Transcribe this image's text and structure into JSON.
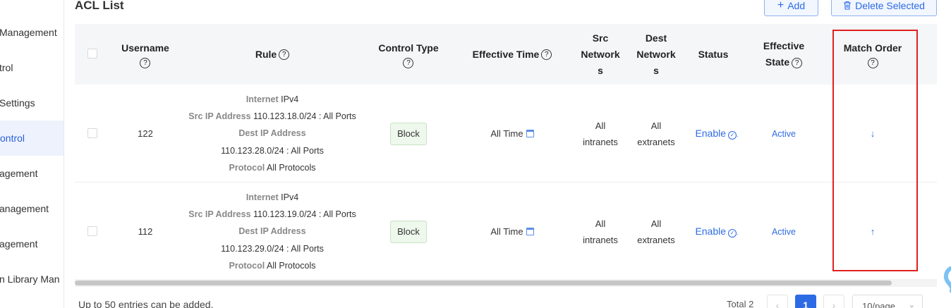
{
  "sidebar": {
    "items": [
      {
        "label": "Management"
      },
      {
        "label": "trol"
      },
      {
        "label": "Settings"
      },
      {
        "label": "ontrol"
      },
      {
        "label": "agement"
      },
      {
        "label": "anagement"
      },
      {
        "label": "agement"
      },
      {
        "label": "n Library Man"
      }
    ]
  },
  "page": {
    "title": "ACL List",
    "add_label": "Add",
    "delete_label": "Delete Selected"
  },
  "table": {
    "headers": {
      "username": "Username",
      "rule": "Rule",
      "control_type": "Control Type",
      "effective_time": "Effective Time",
      "src_networks_1": "Src",
      "src_networks_2": "Network",
      "src_networks_3": "s",
      "dest_networks_1": "Dest",
      "dest_networks_2": "Network",
      "dest_networks_3": "s",
      "status": "Status",
      "effective_state_1": "Effective",
      "effective_state_2": "State",
      "match_order": "Match Order",
      "help_symbol": "?"
    },
    "rule_keys": {
      "internet": "Internet",
      "src_ip": "Src IP Address",
      "dest_ip": "Dest IP Address",
      "protocol": "Protocol"
    },
    "rows": [
      {
        "username": "122",
        "internet": "IPv4",
        "src_ip": "110.123.18.0/24 : All Ports",
        "dest_ip": "110.123.28.0/24 : All Ports",
        "protocol": "All Protocols",
        "control_type": "Block",
        "effective_time": "All Time",
        "src_networks_1": "All",
        "src_networks_2": "intranets",
        "dest_networks_1": "All",
        "dest_networks_2": "extranets",
        "status": "Enable",
        "effective_state": "Active",
        "match_order": "↓"
      },
      {
        "username": "112",
        "internet": "IPv4",
        "src_ip": "110.123.19.0/24 : All Ports",
        "dest_ip": "110.123.29.0/24 : All Ports",
        "protocol": "All Protocols",
        "control_type": "Block",
        "effective_time": "All Time",
        "src_networks_1": "All",
        "src_networks_2": "intranets",
        "dest_networks_1": "All",
        "dest_networks_2": "extranets",
        "status": "Enable",
        "effective_state": "Active",
        "match_order": "↑"
      }
    ]
  },
  "footer": {
    "note": "Up to 50 entries can be added.",
    "total": "Total 2",
    "current_page": "1",
    "page_size": "10/page",
    "prev_symbol": "‹",
    "next_symbol": "›"
  },
  "colors": {
    "accent": "#2d6be4",
    "highlight_box": "#e02020",
    "block_tag_bg": "#eef8ec"
  },
  "icons": {
    "add": "plus-icon",
    "delete": "trash-icon",
    "help": "question-circle-icon",
    "calendar": "calendar-icon",
    "status": "check-circle-icon",
    "page_size": "chevron-down-icon"
  }
}
